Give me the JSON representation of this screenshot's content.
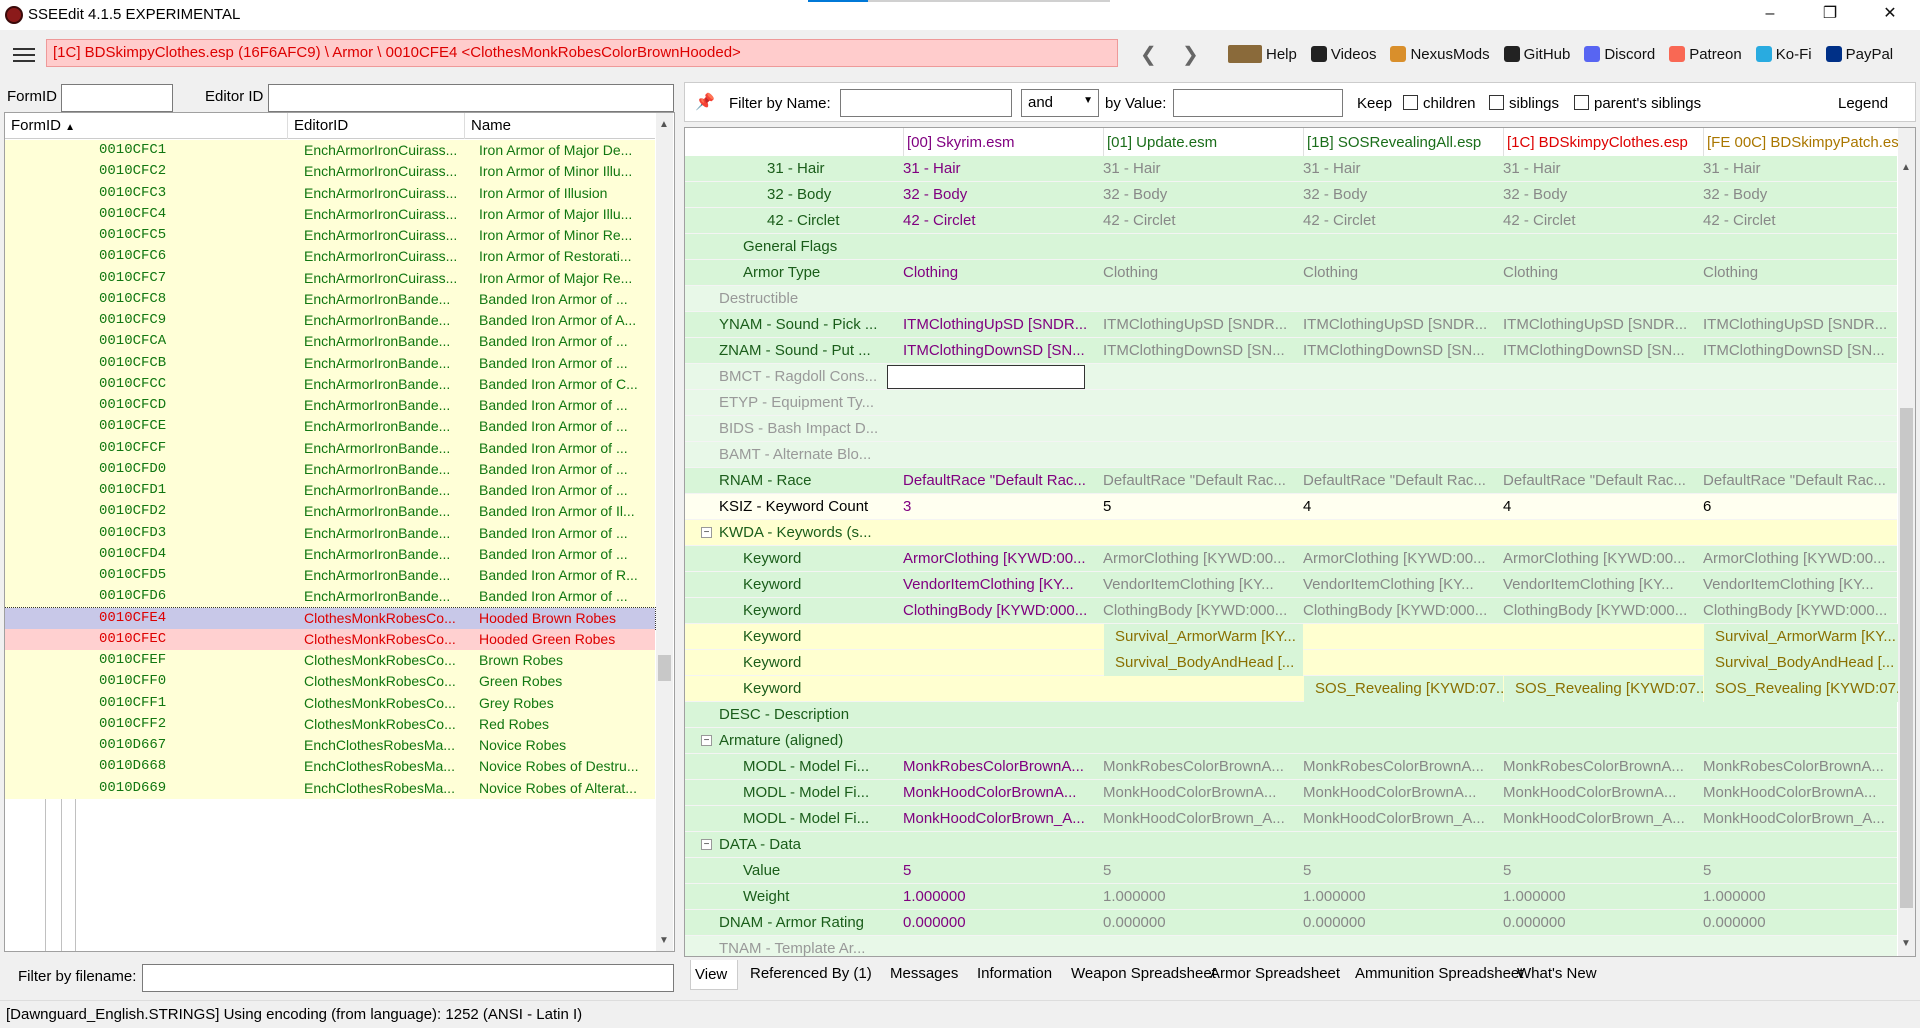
{
  "window": {
    "title": "SSEEdit 4.1.5 EXPERIMENTAL"
  },
  "toolbar": {
    "path": "[1C] BDSkimpyClothes.esp (16F6AFC9) \\ Armor \\ 0010CFE4 <ClothesMonkRobesColorBrownHooded>",
    "links": [
      {
        "label": "Help",
        "icon": "book-icon",
        "color": "#8a6a3a"
      },
      {
        "label": "Videos",
        "icon": "videos-icon",
        "color": "#222222"
      },
      {
        "label": "NexusMods",
        "icon": "nexusmods-icon",
        "color": "#d98f2b"
      },
      {
        "label": "GitHub",
        "icon": "github-icon",
        "color": "#222222"
      },
      {
        "label": "Discord",
        "icon": "discord-icon",
        "color": "#5865f2"
      },
      {
        "label": "Patreon",
        "icon": "patreon-icon",
        "color": "#f96854"
      },
      {
        "label": "Ko-Fi",
        "icon": "kofi-icon",
        "color": "#29abe0"
      },
      {
        "label": "PayPal",
        "icon": "paypal-icon",
        "color": "#003087"
      }
    ]
  },
  "left": {
    "formid_label": "FormID",
    "editorid_label": "Editor ID",
    "columns": [
      "FormID",
      "EditorID",
      "Name"
    ],
    "rows": [
      {
        "fid": "0010CFC1",
        "eid": "EnchArmorIronCuirass...",
        "name": "Iron Armor of Major De..."
      },
      {
        "fid": "0010CFC2",
        "eid": "EnchArmorIronCuirass...",
        "name": "Iron Armor of Minor Illu..."
      },
      {
        "fid": "0010CFC3",
        "eid": "EnchArmorIronCuirass...",
        "name": "Iron Armor of Illusion"
      },
      {
        "fid": "0010CFC4",
        "eid": "EnchArmorIronCuirass...",
        "name": "Iron Armor of Major Illu..."
      },
      {
        "fid": "0010CFC5",
        "eid": "EnchArmorIronCuirass...",
        "name": "Iron Armor of Minor Re..."
      },
      {
        "fid": "0010CFC6",
        "eid": "EnchArmorIronCuirass...",
        "name": "Iron Armor of Restorati..."
      },
      {
        "fid": "0010CFC7",
        "eid": "EnchArmorIronCuirass...",
        "name": "Iron Armor of Major Re..."
      },
      {
        "fid": "0010CFC8",
        "eid": "EnchArmorIronBande...",
        "name": "Banded Iron Armor of ..."
      },
      {
        "fid": "0010CFC9",
        "eid": "EnchArmorIronBande...",
        "name": "Banded Iron Armor of A..."
      },
      {
        "fid": "0010CFCA",
        "eid": "EnchArmorIronBande...",
        "name": "Banded Iron Armor of ..."
      },
      {
        "fid": "0010CFCB",
        "eid": "EnchArmorIronBande...",
        "name": "Banded Iron Armor of ..."
      },
      {
        "fid": "0010CFCC",
        "eid": "EnchArmorIronBande...",
        "name": "Banded Iron Armor of C..."
      },
      {
        "fid": "0010CFCD",
        "eid": "EnchArmorIronBande...",
        "name": "Banded Iron Armor of ..."
      },
      {
        "fid": "0010CFCE",
        "eid": "EnchArmorIronBande...",
        "name": "Banded Iron Armor of ..."
      },
      {
        "fid": "0010CFCF",
        "eid": "EnchArmorIronBande...",
        "name": "Banded Iron Armor of ..."
      },
      {
        "fid": "0010CFD0",
        "eid": "EnchArmorIronBande...",
        "name": "Banded Iron Armor of ..."
      },
      {
        "fid": "0010CFD1",
        "eid": "EnchArmorIronBande...",
        "name": "Banded Iron Armor of ..."
      },
      {
        "fid": "0010CFD2",
        "eid": "EnchArmorIronBande...",
        "name": "Banded Iron Armor of Il..."
      },
      {
        "fid": "0010CFD3",
        "eid": "EnchArmorIronBande...",
        "name": "Banded Iron Armor of ..."
      },
      {
        "fid": "0010CFD4",
        "eid": "EnchArmorIronBande...",
        "name": "Banded Iron Armor of ..."
      },
      {
        "fid": "0010CFD5",
        "eid": "EnchArmorIronBande...",
        "name": "Banded Iron Armor of R..."
      },
      {
        "fid": "0010CFD6",
        "eid": "EnchArmorIronBande...",
        "name": "Banded Iron Armor of ..."
      },
      {
        "fid": "0010CFE4",
        "eid": "ClothesMonkRobesCo...",
        "name": "Hooded Brown Robes",
        "state": "sel"
      },
      {
        "fid": "0010CFEC",
        "eid": "ClothesMonkRobesCo...",
        "name": "Hooded Green Robes",
        "state": "sel2"
      },
      {
        "fid": "0010CFEF",
        "eid": "ClothesMonkRobesCo...",
        "name": "Brown Robes"
      },
      {
        "fid": "0010CFF0",
        "eid": "ClothesMonkRobesCo...",
        "name": "Green Robes"
      },
      {
        "fid": "0010CFF1",
        "eid": "ClothesMonkRobesCo...",
        "name": "Grey Robes"
      },
      {
        "fid": "0010CFF2",
        "eid": "ClothesMonkRobesCo...",
        "name": "Red Robes"
      },
      {
        "fid": "0010D667",
        "eid": "EnchClothesRobesMa...",
        "name": "Novice Robes"
      },
      {
        "fid": "0010D668",
        "eid": "EnchClothesRobesMa...",
        "name": "Novice Robes of Destru..."
      },
      {
        "fid": "0010D669",
        "eid": "EnchClothesRobesMa...",
        "name": "Novice Robes of Alterat..."
      }
    ],
    "filter_label": "Filter by filename:"
  },
  "right": {
    "filter": {
      "by_name": "Filter by Name:",
      "op": "and",
      "by_value": "by Value:",
      "keep": "Keep",
      "children": "children",
      "siblings": "siblings",
      "parents": "parent's siblings",
      "legend": "Legend"
    },
    "plugins": [
      {
        "label": "[00] Skyrim.esm",
        "color": "#800080"
      },
      {
        "label": "[01] Update.esm",
        "color": "#1a6d1a"
      },
      {
        "label": "[1B] SOSRevealingAll.esp",
        "color": "#1a6d1a"
      },
      {
        "label": "[1C] BDSkimpyClothes.esp",
        "color": "#dd0000"
      },
      {
        "label": "[FE 00C] BDSkimpyPatch.esp",
        "color": "#aa7700"
      }
    ],
    "rows": [
      {
        "indent": 3,
        "label": "31 - Hair",
        "vals": [
          "31 - Hair",
          "31 - Hair",
          "31 - Hair",
          "31 - Hair",
          "31 - Hair"
        ],
        "bg": "#d8f5d8"
      },
      {
        "indent": 3,
        "label": "32 - Body",
        "vals": [
          "32 - Body",
          "32 - Body",
          "32 - Body",
          "32 - Body",
          "32 - Body"
        ],
        "bg": "#d8f5d8"
      },
      {
        "indent": 3,
        "label": "42 - Circlet",
        "vals": [
          "42 - Circlet",
          "42 - Circlet",
          "42 - Circlet",
          "42 - Circlet",
          "42 - Circlet"
        ],
        "bg": "#d8f5d8"
      },
      {
        "indent": 2,
        "label": "General Flags",
        "vals": [
          "",
          "",
          "",
          "",
          ""
        ],
        "bg": "#d8f5d8"
      },
      {
        "indent": 2,
        "label": "Armor Type",
        "vals": [
          "Clothing",
          "Clothing",
          "Clothing",
          "Clothing",
          "Clothing"
        ],
        "bg": "#d8f5d8"
      },
      {
        "indent": 1,
        "label": "Destructible",
        "vals": [
          "",
          "",
          "",
          "",
          ""
        ],
        "bg": "#e8f8e8",
        "dim": true
      },
      {
        "indent": 1,
        "label": "YNAM - Sound - Pick ...",
        "vals": [
          "ITMClothingUpSD [SNDR...",
          "ITMClothingUpSD [SNDR...",
          "ITMClothingUpSD [SNDR...",
          "ITMClothingUpSD [SNDR...",
          "ITMClothingUpSD [SNDR..."
        ],
        "bg": "#d8f5d8"
      },
      {
        "indent": 1,
        "label": "ZNAM - Sound - Put ...",
        "vals": [
          "ITMClothingDownSD [SN...",
          "ITMClothingDownSD [SN...",
          "ITMClothingDownSD [SN...",
          "ITMClothingDownSD [SN...",
          "ITMClothingDownSD [SN..."
        ],
        "bg": "#d8f5d8"
      },
      {
        "indent": 1,
        "label": "BMCT - Ragdoll Cons...",
        "vals": [
          "",
          "",
          "",
          "",
          ""
        ],
        "bg": "#e8f8e8",
        "dim": true,
        "focus": true
      },
      {
        "indent": 1,
        "label": "ETYP - Equipment Ty...",
        "vals": [
          "",
          "",
          "",
          "",
          ""
        ],
        "bg": "#e8f8e8",
        "dim": true
      },
      {
        "indent": 1,
        "label": "BIDS - Bash Impact D...",
        "vals": [
          "",
          "",
          "",
          "",
          ""
        ],
        "bg": "#e8f8e8",
        "dim": true
      },
      {
        "indent": 1,
        "label": "BAMT - Alternate Blo...",
        "vals": [
          "",
          "",
          "",
          "",
          ""
        ],
        "bg": "#e8f8e8",
        "dim": true
      },
      {
        "indent": 1,
        "label": "RNAM - Race",
        "vals": [
          "DefaultRace \"Default Rac...",
          "DefaultRace \"Default Rac...",
          "DefaultRace \"Default Rac...",
          "DefaultRace \"Default Rac...",
          "DefaultRace \"Default Rac..."
        ],
        "bg": "#d8f5d8"
      },
      {
        "indent": 1,
        "label": "KSIZ - Keyword Count",
        "vals": [
          "3",
          "5",
          "4",
          "4",
          "6"
        ],
        "bg": "#fffff0",
        "black": true
      },
      {
        "indent": 1,
        "label": "KWDA - Keywords (s...",
        "vals": [
          "",
          "",
          "",
          "",
          ""
        ],
        "bg": "#ffffd0",
        "exp": true
      },
      {
        "indent": 2,
        "label": "Keyword",
        "vals": [
          "ArmorClothing [KYWD:00...",
          "ArmorClothing [KYWD:00...",
          "ArmorClothing [KYWD:00...",
          "ArmorClothing [KYWD:00...",
          "ArmorClothing [KYWD:00..."
        ],
        "bg": "#d8f5d8"
      },
      {
        "indent": 2,
        "label": "Keyword",
        "vals": [
          "VendorItemClothing [KY...",
          "VendorItemClothing [KY...",
          "VendorItemClothing [KY...",
          "VendorItemClothing [KY...",
          "VendorItemClothing [KY..."
        ],
        "bg": "#d8f5d8"
      },
      {
        "indent": 2,
        "label": "Keyword",
        "vals": [
          "ClothingBody [KYWD:000...",
          "ClothingBody [KYWD:000...",
          "ClothingBody [KYWD:000...",
          "ClothingBody [KYWD:000...",
          "ClothingBody [KYWD:000..."
        ],
        "bg": "#d8f5d8"
      },
      {
        "indent": 2,
        "label": "Keyword",
        "vals": [
          "",
          "Survival_ArmorWarm [KY...",
          "",
          "",
          "Survival_ArmorWarm [KY..."
        ],
        "bg": "#ffffd0",
        "mix": [
          0,
          1,
          0,
          0,
          1
        ]
      },
      {
        "indent": 2,
        "label": "Keyword",
        "vals": [
          "",
          "Survival_BodyAndHead [...",
          "",
          "",
          "Survival_BodyAndHead [..."
        ],
        "bg": "#ffffd0",
        "mix": [
          0,
          1,
          0,
          0,
          1
        ]
      },
      {
        "indent": 2,
        "label": "Keyword",
        "vals": [
          "",
          "",
          "SOS_Revealing [KYWD:07...",
          "SOS_Revealing [KYWD:07...",
          "SOS_Revealing [KYWD:07..."
        ],
        "bg": "#ffffd0",
        "mix": [
          0,
          0,
          1,
          1,
          1
        ]
      },
      {
        "indent": 1,
        "label": "DESC - Description",
        "vals": [
          "",
          "",
          "",
          "",
          ""
        ],
        "bg": "#d8f5d8"
      },
      {
        "indent": 1,
        "label": "Armature (aligned)",
        "vals": [
          "",
          "",
          "",
          "",
          ""
        ],
        "bg": "#d8f5d8",
        "exp": true
      },
      {
        "indent": 2,
        "label": "MODL - Model Fi...",
        "vals": [
          "MonkRobesColorBrownA...",
          "MonkRobesColorBrownA...",
          "MonkRobesColorBrownA...",
          "MonkRobesColorBrownA...",
          "MonkRobesColorBrownA..."
        ],
        "bg": "#d8f5d8"
      },
      {
        "indent": 2,
        "label": "MODL - Model Fi...",
        "vals": [
          "MonkHoodColorBrownA...",
          "MonkHoodColorBrownA...",
          "MonkHoodColorBrownA...",
          "MonkHoodColorBrownA...",
          "MonkHoodColorBrownA..."
        ],
        "bg": "#d8f5d8"
      },
      {
        "indent": 2,
        "label": "MODL - Model Fi...",
        "vals": [
          "MonkHoodColorBrown_A...",
          "MonkHoodColorBrown_A...",
          "MonkHoodColorBrown_A...",
          "MonkHoodColorBrown_A...",
          "MonkHoodColorBrown_A..."
        ],
        "bg": "#d8f5d8"
      },
      {
        "indent": 1,
        "label": "DATA - Data",
        "vals": [
          "",
          "",
          "",
          "",
          ""
        ],
        "bg": "#d8f5d8",
        "exp": true
      },
      {
        "indent": 2,
        "label": "Value",
        "vals": [
          "5",
          "5",
          "5",
          "5",
          "5"
        ],
        "bg": "#d8f5d8"
      },
      {
        "indent": 2,
        "label": "Weight",
        "vals": [
          "1.000000",
          "1.000000",
          "1.000000",
          "1.000000",
          "1.000000"
        ],
        "bg": "#d8f5d8"
      },
      {
        "indent": 1,
        "label": "DNAM - Armor Rating",
        "vals": [
          "0.000000",
          "0.000000",
          "0.000000",
          "0.000000",
          "0.000000"
        ],
        "bg": "#d8f5d8"
      },
      {
        "indent": 1,
        "label": "TNAM - Template Ar...",
        "vals": [
          "",
          "",
          "",
          "",
          ""
        ],
        "bg": "#e8f8e8",
        "dim": true
      }
    ],
    "tabs": [
      "View",
      "Referenced By (1)",
      "Messages",
      "Information",
      "Weapon Spreadsheet",
      "Armor Spreadsheet",
      "Ammunition Spreadsheet",
      "What's New"
    ]
  },
  "status": "[Dawnguard_English.STRINGS] Using encoding (from language): 1252  (ANSI - Latin I)"
}
